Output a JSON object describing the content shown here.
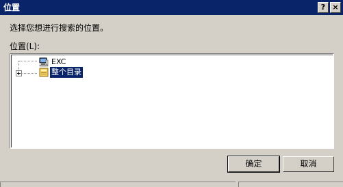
{
  "window": {
    "title": "位置",
    "help_label": "?",
    "close_label": "×"
  },
  "prompt": "选择您想进行搜索的位置。",
  "tree": {
    "label": "位置(L):",
    "nodes": [
      {
        "label": "EXC",
        "icon": "computer-icon"
      },
      {
        "label": "整个目录",
        "icon": "directory-icon",
        "selected": true
      }
    ]
  },
  "buttons": {
    "ok": "确定",
    "cancel": "取消"
  },
  "colors": {
    "titlebar": "#0a246a",
    "face": "#d4d0c8",
    "selection": "#0a246a"
  }
}
